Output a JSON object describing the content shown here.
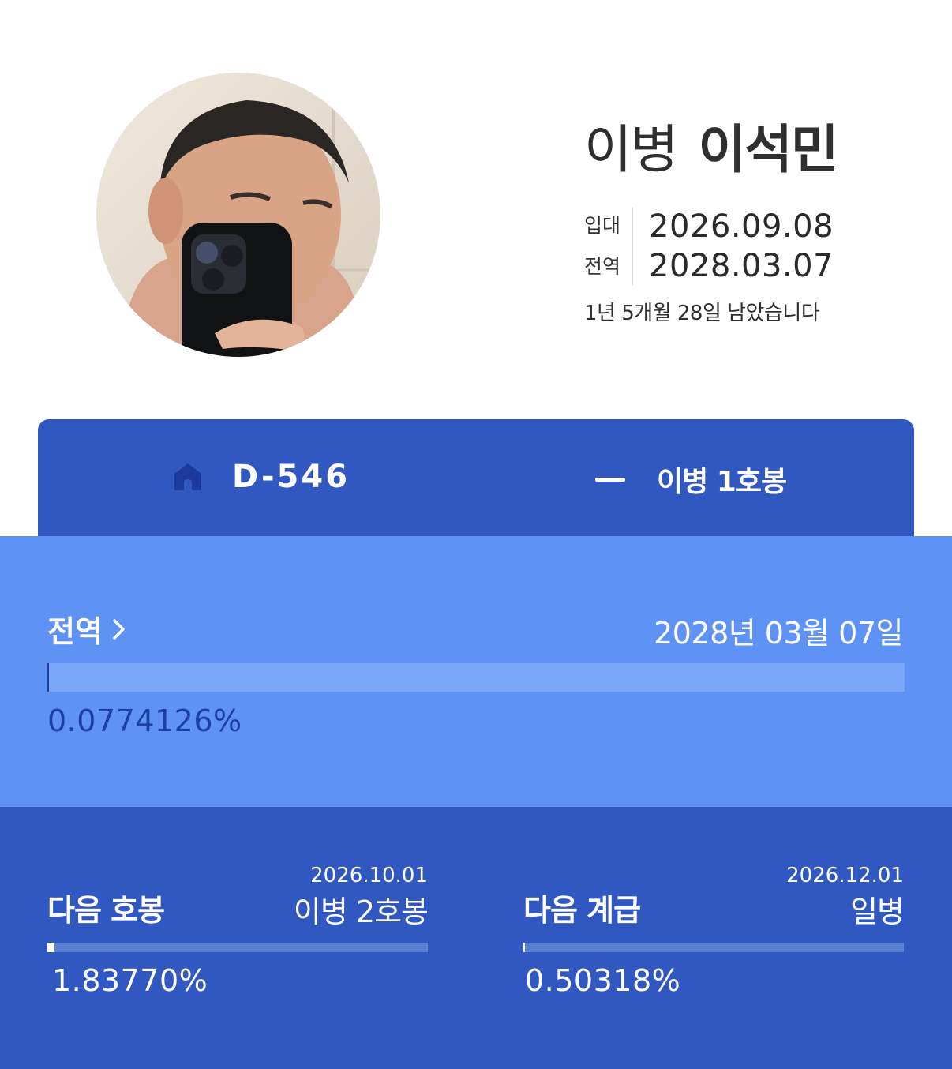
{
  "profile": {
    "rank": "이병",
    "name": "이석민",
    "enlist_label": "입대",
    "enlist_date": "2026.09.08",
    "discharge_label": "전역",
    "discharge_date": "2028.03.07",
    "remaining": "1년 5개월 28일 남았습니다"
  },
  "topbar": {
    "dday": "D-546",
    "current_rank": "이병 1호봉",
    "icons": [
      "home-icon",
      "dash-icon"
    ],
    "home_icon_color": "#1c3a9e"
  },
  "discharge": {
    "title": "전역",
    "date_text": "2028년 03월 07일",
    "progress_text": "0.0774126%",
    "progress_value": 0.0774126
  },
  "next_step": {
    "label": "다음 호봉",
    "date": "2026.10.01",
    "rank": "이병 2호봉",
    "progress_text": "1.83770%",
    "progress_value": 1.8377
  },
  "next_rank": {
    "label": "다음 계급",
    "date": "2026.12.01",
    "rank": "일병",
    "progress_text": "0.50318%",
    "progress_value": 0.50318
  },
  "colors": {
    "primary_blue": "#3058c0",
    "light_blue": "#5f92f5",
    "track_light": "#7aa6f8",
    "dark_text_blue": "#1c3fa6"
  }
}
